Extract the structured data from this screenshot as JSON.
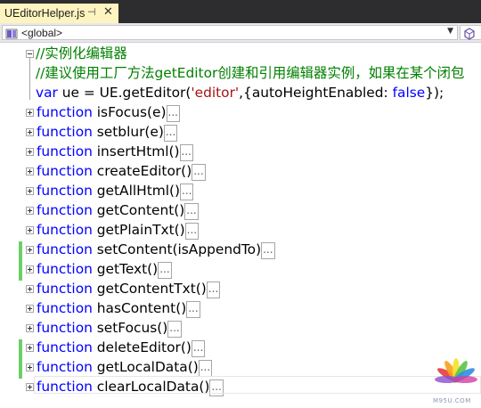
{
  "tab": {
    "title": "UEditorHelper.js",
    "pin_glyph": "⊣",
    "close_glyph": "✕"
  },
  "navbar": {
    "scope": "<global>"
  },
  "code": {
    "comment1": "//实例化编辑器",
    "comment2": "//建议使用工厂方法getEditor创建和引用编辑器实例，如果在某个闭包",
    "var_kw": "var",
    "var_rest1": " ue = UE.getEditor(",
    "var_str": "'editor'",
    "var_rest2": ",{autoHeightEnabled: ",
    "var_false": "false",
    "var_rest3": "});",
    "keyword": "function",
    "collapsed_marker": "...",
    "functions": [
      "isFocus(e)",
      "setblur(e)",
      "insertHtml()",
      "createEditor()",
      "getAllHtml()",
      "getContent()",
      "getPlainTxt()",
      "setContent(isAppendTo)",
      "getText()",
      "getContentTxt()",
      "hasContent()",
      "setFocus()",
      "deleteEditor()",
      "getLocalData()",
      "clearLocalData()"
    ]
  },
  "watermark": {
    "text": "M95U.COM"
  },
  "colors": {
    "keyword": "#0000ff",
    "comment": "#008000",
    "string": "#a31515",
    "change_bar": "#6bcf65",
    "tab": "#fdf4bf",
    "tabstrip": "#2d2d30"
  },
  "icons": {
    "scope": "js-scope-icon",
    "member": "member-cube-icon",
    "expand": "plus-expander-icon",
    "collapse": "minus-collapser-icon"
  }
}
